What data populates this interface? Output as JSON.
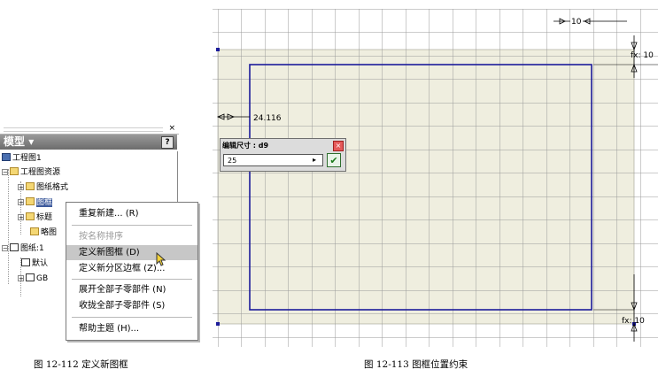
{
  "browser": {
    "close_glyph": "×",
    "title": "模型",
    "title_dropdown": "▾",
    "help_glyph": "?",
    "tree": [
      {
        "label": "工程图1",
        "icon": "drawing-icon"
      },
      {
        "label": "工程图资源",
        "icon": "folder-icon"
      },
      {
        "label": "图纸格式",
        "icon": "folder-icon"
      },
      {
        "label": "图框",
        "icon": "folder-icon"
      },
      {
        "label": "标题",
        "icon": "folder-icon"
      },
      {
        "label": "略图",
        "icon": "sketch-icon"
      },
      {
        "label": "图纸:1",
        "icon": "sheet-icon"
      },
      {
        "label": "默认",
        "icon": "border-icon"
      },
      {
        "label": "GB",
        "icon": "titleblock-icon"
      }
    ]
  },
  "context_menu": {
    "items": [
      {
        "label": "重复新建... (R)",
        "state": "enabled"
      },
      {
        "label": "按名称排序",
        "state": "disabled"
      },
      {
        "label": "定义新图框 (D)",
        "state": "highlighted"
      },
      {
        "label": "定义新分区边框 (Z)...",
        "state": "enabled"
      },
      {
        "label": "展开全部子零部件 (N)",
        "state": "enabled"
      },
      {
        "label": "收拢全部子零部件 (S)",
        "state": "enabled"
      },
      {
        "label": "帮助主题 (H)...",
        "state": "enabled"
      }
    ]
  },
  "captions": {
    "left": "图 12-112  定义新图框",
    "right": "图 12-113  图框位置约束"
  },
  "dimensions": {
    "top_right": "10",
    "right_top": "fx: 10",
    "left": "24.116",
    "right_bottom": "fx: 10"
  },
  "edit_dimension": {
    "title": "编辑尺寸 : d9",
    "value": "25",
    "confirm_glyph": "✔",
    "arrow_glyph": "▸"
  },
  "colors": {
    "sheet_fill": "#ecebd9",
    "border_line": "#1c1c9a",
    "grid_line": "#9a9a9a",
    "menu_highlight": "#c7c7c7"
  }
}
